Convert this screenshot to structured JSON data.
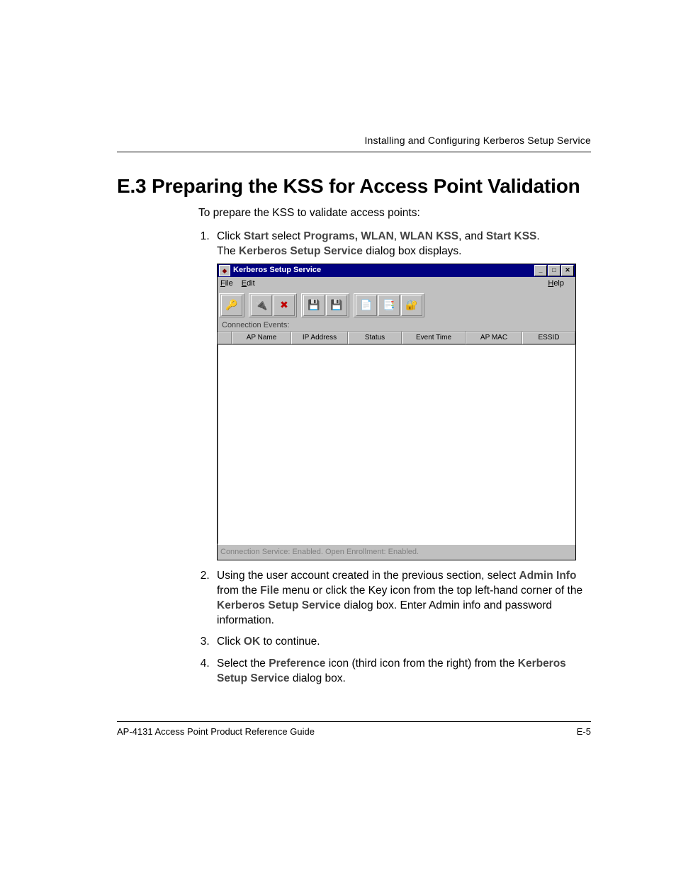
{
  "header": {
    "running_title": "Installing and Configuring Kerberos Setup Service"
  },
  "section": {
    "heading": "E.3 Preparing the KSS for Access Point Validation",
    "intro": "To prepare the KSS to validate access points:"
  },
  "steps": {
    "s1": {
      "prefix": "Click ",
      "b1": "Start",
      "t1": " select ",
      "b2": "Programs, WLAN",
      "t2": ", ",
      "b3": "WLAN KSS",
      "t3": ", and ",
      "b4": "Start KSS",
      "t4": ".",
      "line2a": "The ",
      "line2b": "Kerberos Setup Service",
      "line2c": " dialog box displays."
    },
    "s2": {
      "t1": "Using the user account created in the previous section, select ",
      "b1": "Admin Info",
      "t2": " from the ",
      "b2": "File",
      "t3": " menu or click the Key icon from the top left-hand corner of the ",
      "b3": "Kerberos Setup Service",
      "t4": " dialog box. Enter Admin info and password information."
    },
    "s3": {
      "t1": "Click ",
      "b1": "OK",
      "t2": " to continue."
    },
    "s4": {
      "t1": "Select the ",
      "b1": "Preference",
      "t2": " icon (third icon from the right) from the ",
      "b2": "Kerberos Setup Service",
      "t3": " dialog box."
    }
  },
  "window": {
    "title": "Kerberos Setup Service",
    "menu": {
      "file": "File",
      "edit": "Edit",
      "help": "Help"
    },
    "section_label": "Connection Events:",
    "columns": [
      "AP Name",
      "IP Address",
      "Status",
      "Event Time",
      "AP MAC",
      "ESSID"
    ],
    "status": "Connection Service: Enabled.  Open Enrollment: Enabled."
  },
  "footer": {
    "left": "AP-4131 Access Point Product Reference Guide",
    "right": "E-5"
  }
}
